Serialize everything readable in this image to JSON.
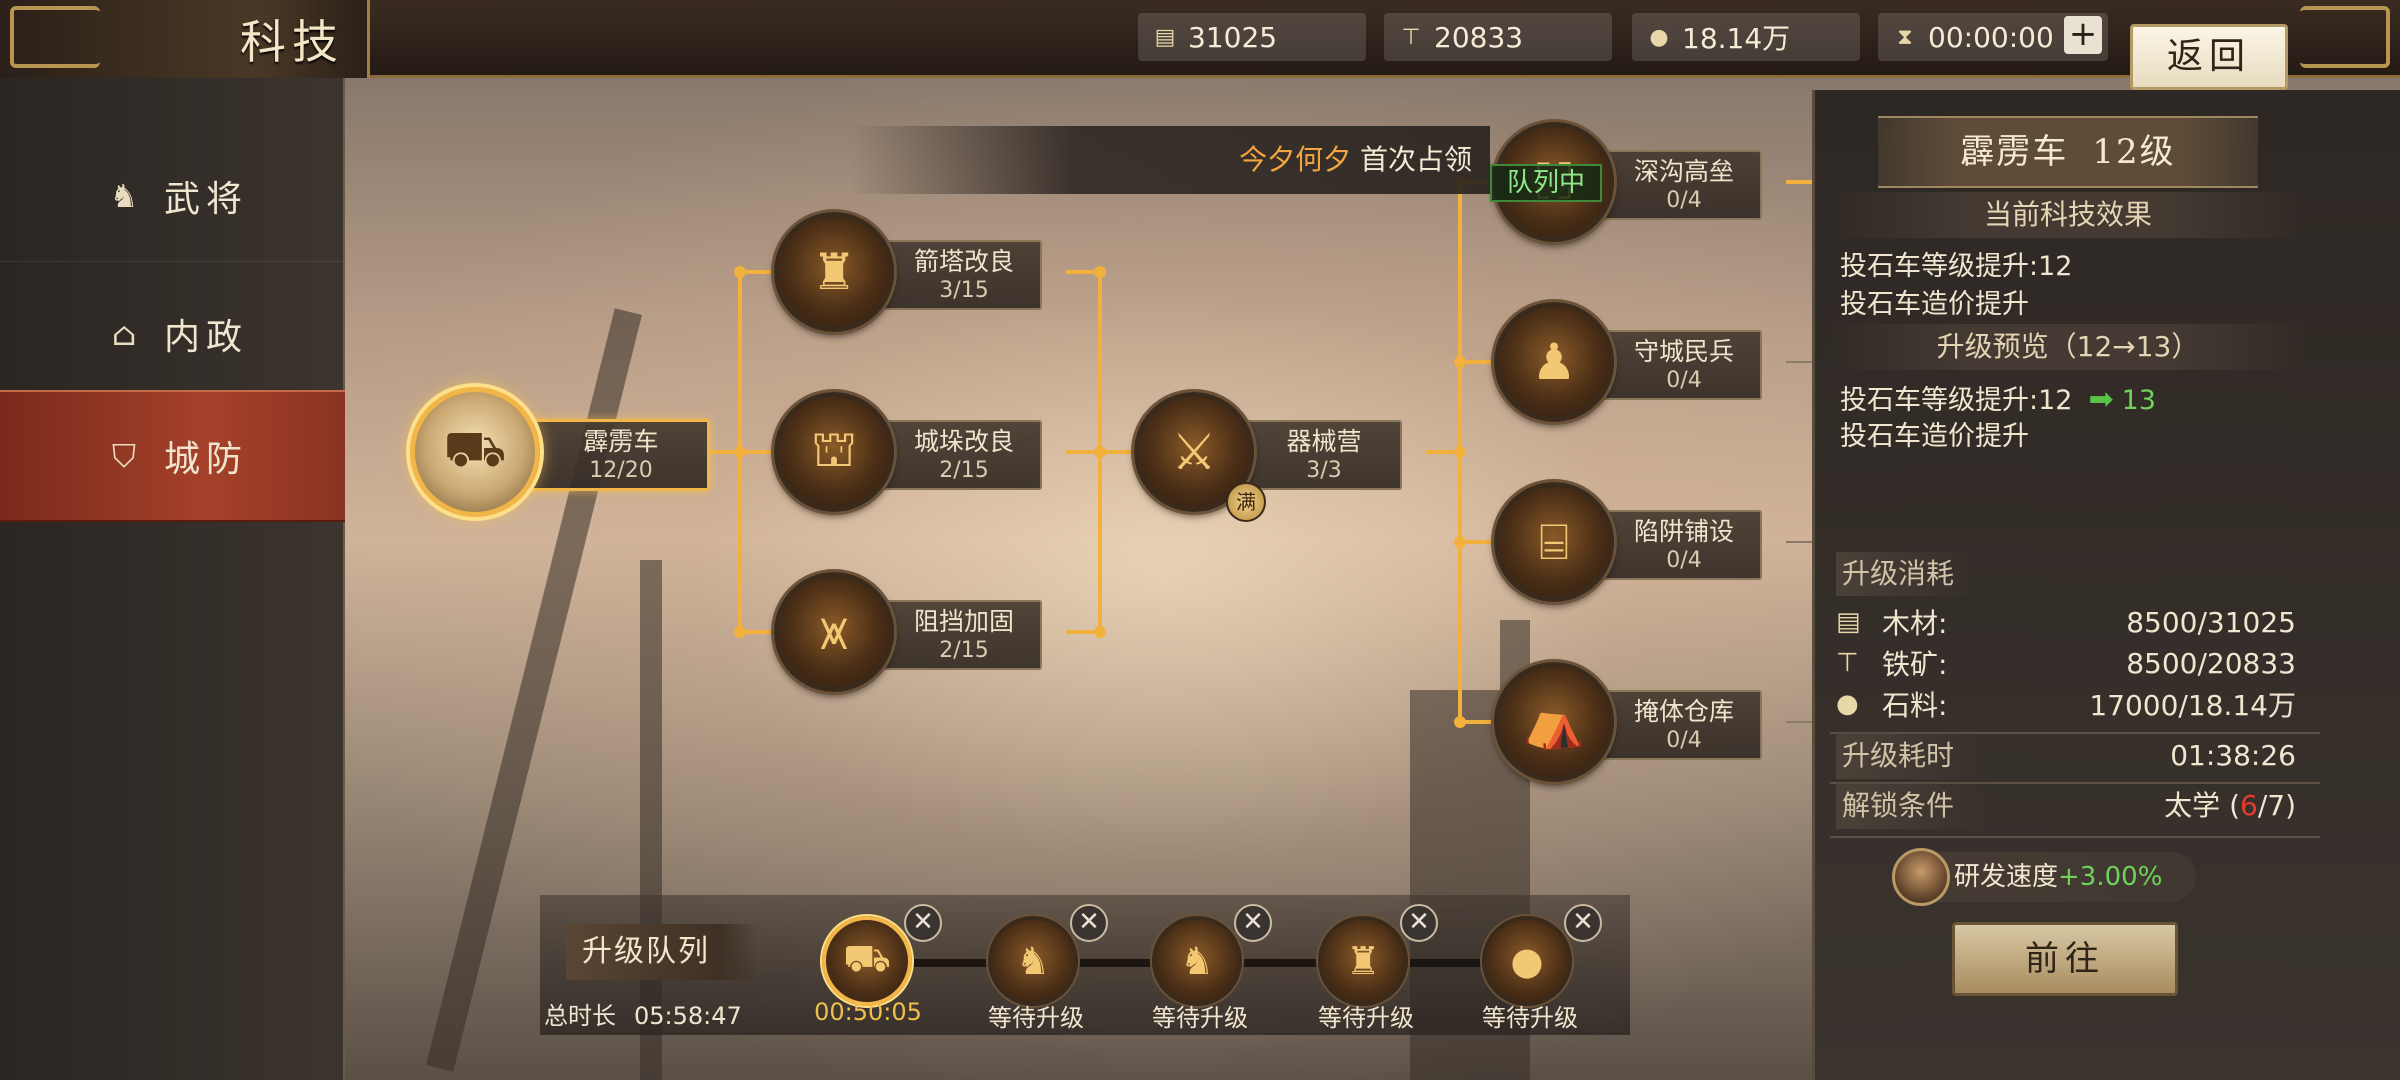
{
  "header": {
    "title": "科技",
    "resources": [
      {
        "icon": "wood-icon",
        "value": "31025"
      },
      {
        "icon": "iron-icon",
        "value": "20833"
      },
      {
        "icon": "stone-icon",
        "value": "18.14万"
      },
      {
        "icon": "speedup-icon",
        "value": "00:00:00"
      }
    ],
    "back_label": "返回"
  },
  "sidebar": {
    "tabs": [
      {
        "label": "武将",
        "icon": "general-icon",
        "active": false
      },
      {
        "label": "内政",
        "icon": "building-icon",
        "active": false
      },
      {
        "label": "城防",
        "icon": "shield-icon",
        "active": true
      }
    ]
  },
  "banner": {
    "highlight": "今夕何夕",
    "text": "首次占领"
  },
  "tree": {
    "nodes": [
      {
        "id": "pili",
        "name": "霹雳车",
        "level": "12/20",
        "icon": "catapult-icon"
      },
      {
        "id": "jianta",
        "name": "箭塔改良",
        "level": "3/15",
        "icon": "arrow-tower-icon"
      },
      {
        "id": "chengduo",
        "name": "城垛改良",
        "level": "2/15",
        "icon": "battlement-icon"
      },
      {
        "id": "zudang",
        "name": "阻挡加固",
        "level": "2/15",
        "icon": "barricade-icon"
      },
      {
        "id": "qixie",
        "name": "器械营",
        "level": "3/3",
        "icon": "siege-camp-icon",
        "badge": "满"
      },
      {
        "id": "shengou",
        "name": "深沟高垒",
        "level": "0/4",
        "icon": "moat-icon",
        "tag": "队列中"
      },
      {
        "id": "shoucheng",
        "name": "守城民兵",
        "level": "0/4",
        "icon": "militia-icon"
      },
      {
        "id": "xianjing",
        "name": "陷阱铺设",
        "level": "0/4",
        "icon": "trap-icon"
      },
      {
        "id": "yanti",
        "name": "掩体仓库",
        "level": "0/4",
        "icon": "bunker-icon"
      }
    ]
  },
  "queue": {
    "label": "升级队列",
    "total_label": "总时长",
    "total_time": "05:58:47",
    "slots": [
      {
        "icon": "catapult-icon",
        "status": "00:50:05",
        "active": true
      },
      {
        "icon": "general-icon",
        "status": "等待升级"
      },
      {
        "icon": "general-icon",
        "status": "等待升级"
      },
      {
        "icon": "arrow-tower-icon",
        "status": "等待升级"
      },
      {
        "icon": "stone-icon",
        "status": "等待升级"
      }
    ],
    "close_glyph": "✕"
  },
  "info": {
    "name": "霹雳车",
    "level": "12级",
    "current_head": "当前科技效果",
    "current_lines": [
      "投石车等级提升:12",
      "投石车造价提升"
    ],
    "preview_head": "升级预览（12→13）",
    "preview_line1_label": "投石车等级提升:12",
    "preview_line1_new": "13",
    "preview_line2": "投石车造价提升",
    "cost_head": "升级消耗",
    "costs": [
      {
        "icon": "wood-icon",
        "name": "木材:",
        "value": "8500/31025"
      },
      {
        "icon": "iron-icon",
        "name": "铁矿:",
        "value": "8500/20833"
      },
      {
        "icon": "stone-icon",
        "name": "石料:",
        "value": "17000/18.14万"
      }
    ],
    "time_label": "升级耗时",
    "time_value": "01:38:26",
    "unlock_label": "解锁条件",
    "unlock_name": "太学 (",
    "unlock_have": "6",
    "unlock_need": "/7)",
    "speed_label": "研发速度",
    "speed_value": "+3.00%",
    "go_label": "前往"
  },
  "colors": {
    "accent_gold": "#f2b648",
    "active_tab": "#a5412a",
    "positive": "#6fd35a",
    "warning_red": "#e83a2c"
  }
}
